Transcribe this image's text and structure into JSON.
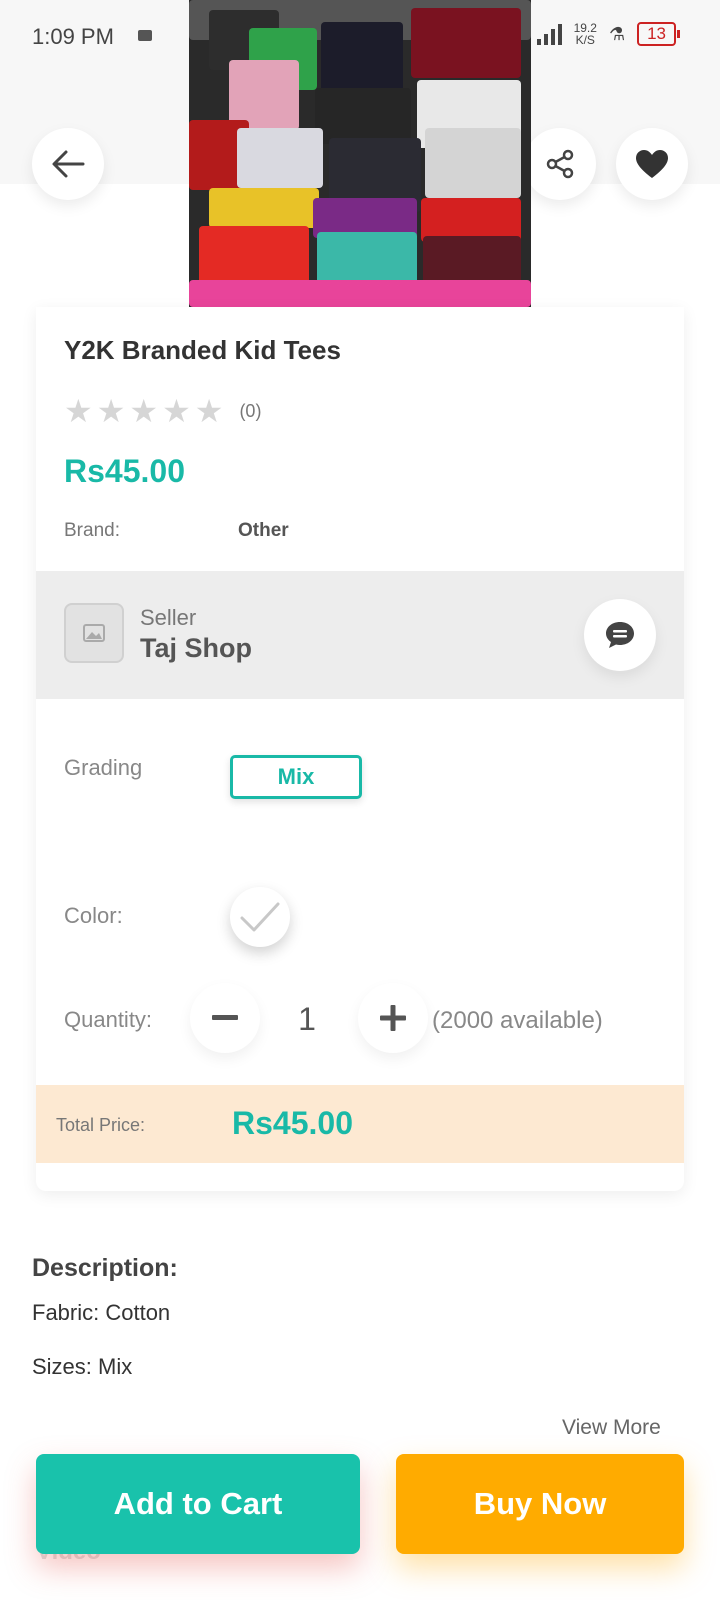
{
  "status_bar": {
    "time": "1:09 PM",
    "net_speed_value": "19.2",
    "net_speed_unit": "K/S",
    "battery": "13"
  },
  "header": {
    "back_icon": "arrow-left-icon",
    "share_icon": "share-icon",
    "favorite_icon": "heart-icon"
  },
  "product": {
    "image_alt": "product-photo",
    "title": "Y2K Branded Kid Tees",
    "rating_stars": 0,
    "review_count": "(0)",
    "price": "Rs45.00",
    "brand_label": "Brand:",
    "brand_value": "Other"
  },
  "seller": {
    "label": "Seller",
    "name": "Taj Shop",
    "chat_icon": "chat-bubble-icon"
  },
  "options": {
    "grading_label": "Grading",
    "grading_value": "Mix",
    "color_label": "Color:",
    "quantity_label": "Quantity:",
    "quantity_value": "1",
    "available": "(2000 available)"
  },
  "total": {
    "label": "Total Price:",
    "value": "Rs45.00"
  },
  "description": {
    "heading": "Description:",
    "lines": [
      "Fabric: Cotton",
      "Sizes: Mix"
    ],
    "view_more": "View More",
    "next_section": "Video"
  },
  "actions": {
    "add_to_cart": "Add to Cart",
    "buy_now": "Buy Now"
  },
  "colors": {
    "accent": "#19b9a7",
    "buy": "#ffab00",
    "total_bg": "#fde9d2"
  }
}
